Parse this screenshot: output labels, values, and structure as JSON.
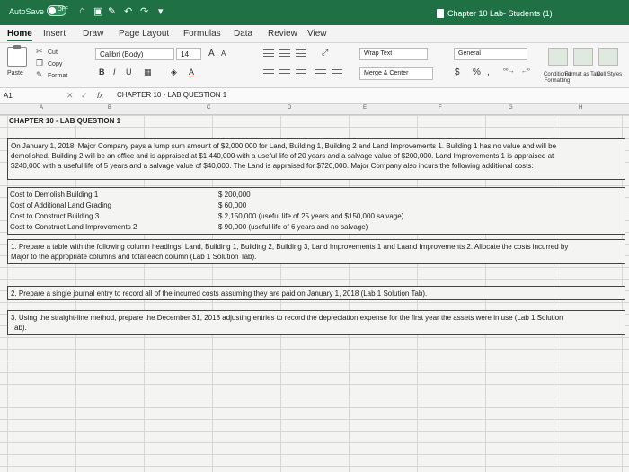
{
  "titlebar": {
    "autosave_label": "AutoSave",
    "autosave_state": "OFF",
    "document_title": "Chapter 10 Lab- Students (1)"
  },
  "tabs": [
    "Home",
    "Insert",
    "Draw",
    "Page Layout",
    "Formulas",
    "Data",
    "Review",
    "View"
  ],
  "ribbon": {
    "paste_label": "Paste",
    "cut_label": "Cut",
    "copy_label": "Copy",
    "format_label": "Format",
    "font_name": "Calibri (Body)",
    "font_size": "14",
    "bold": "B",
    "italic": "I",
    "underline": "U",
    "font_color_label": "A",
    "grow_font": "A",
    "shrink_font": "A",
    "wrap_text_label": "Wrap Text",
    "merge_center_label": "Merge & Center",
    "number_format": "General",
    "currency": "$",
    "percent": "%",
    "comma": ",",
    "conditional_formatting_label": "Conditional Formatting",
    "format_as_table_label": "Format as Table",
    "cell_styles_label": "Cell Styles"
  },
  "formula_bar": {
    "name_box": "A1",
    "fx": "fx",
    "content": "CHAPTER 10 - LAB QUESTION 1"
  },
  "columns": [
    "A",
    "B",
    "C",
    "D",
    "E",
    "F",
    "G",
    "H"
  ],
  "sheet": {
    "title": "CHAPTER 10 - LAB QUESTION 1",
    "intro_1": "On January 1, 2018, Major Company pays a lump sum amount of $2,000,000 for Land, Building 1, Building 2 and Land Improvements 1.  Building 1 has no value and will be",
    "intro_2": "demolished. Building 2 will be an office and is appraised at $1,440,000 with a useful life of 20 years and a salvage value of $200,000.  Land Improvements 1 is appraised at",
    "intro_3": "$240,000 with a useful life of 5 years and a salvage value of $40,000. The Land is appraised for $720,000.  Major Company also incurs the following additional costs:",
    "costs": [
      {
        "label": "Cost to Demolish Building 1",
        "value": "$    200,000"
      },
      {
        "label": "Cost of Additional Land Grading",
        "value": "$      60,000"
      },
      {
        "label": "Cost to Construct Building 3",
        "value": "$ 2,150,000 (useful life of 25 years and $150,000 salvage)"
      },
      {
        "label": "Cost to Construct Land Improvements 2",
        "value": "$      90,000 (useful life of 6 years and no salvage)"
      }
    ],
    "q1_line1": "1. Prepare a table with the following column headings: Land, Building 1, Building 2, Building 3, Land Improvements 1 and Laand Improvements 2.  Allocate the costs incurred by",
    "q1_line2": "Major to the appropriate columns and total each column (Lab 1 Solution Tab).",
    "q2": "2. Prepare a single journal entry to record all of the incurred costs assuming they are paid on January 1, 2018 (Lab 1 Solution Tab).",
    "q3_line1": "3. Using the straight-line method, prepare the December 31, 2018 adjusting entries to record the depreciation expense for the first year the assets were in use (Lab 1 Solution",
    "q3_line2": "Tab)."
  },
  "colors": {
    "excel_green": "#1f7145",
    "cell_background": "#f4f4f2"
  }
}
